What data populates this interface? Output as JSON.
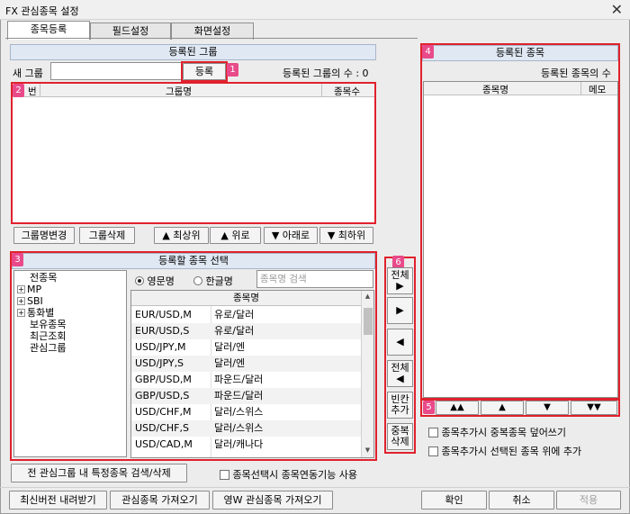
{
  "window": {
    "title": "FX 관심종목 설정",
    "close": "✕"
  },
  "tabs": [
    {
      "label": "종목등록"
    },
    {
      "label": "필드설정"
    },
    {
      "label": "화면설정"
    }
  ],
  "groups": {
    "header": "등록된 그룹",
    "new_group_label": "새 그룹",
    "new_group_value": "",
    "register_button": "등록",
    "count_label": "등록된 그룹의 수 : 0",
    "columns": [
      "번",
      "그룹명",
      "종목수"
    ],
    "buttons": {
      "rename": "그룹명변경",
      "delete": "그룹삭제",
      "top": "▲ 최상위",
      "up": "▲ 위로",
      "down": "▼ 아래로",
      "bottom": "▼ 최하위"
    }
  },
  "badges": [
    "1",
    "2",
    "3",
    "4",
    "5",
    "6"
  ],
  "selection": {
    "header": "등록할 종목 선택",
    "tree": [
      {
        "label": "전종목",
        "expandable": false
      },
      {
        "label": "MP",
        "expandable": true
      },
      {
        "label": "SBI",
        "expandable": true
      },
      {
        "label": "통화별",
        "expandable": true
      },
      {
        "label": "보유종목",
        "expandable": false
      },
      {
        "label": "최근조회",
        "expandable": false
      },
      {
        "label": "관심그룹",
        "expandable": false
      }
    ],
    "radio_english": "영문명",
    "radio_korean": "한글명",
    "search_placeholder": "종목명 검색",
    "column": "종목명",
    "symbols": [
      {
        "code": "EUR/USD,M",
        "name": "유로/달러"
      },
      {
        "code": "EUR/USD,S",
        "name": "유로/달러"
      },
      {
        "code": "USD/JPY,M",
        "name": "달러/엔"
      },
      {
        "code": "USD/JPY,S",
        "name": "달러/엔"
      },
      {
        "code": "GBP/USD,M",
        "name": "파운드/달러"
      },
      {
        "code": "GBP/USD,S",
        "name": "파운드/달러"
      },
      {
        "code": "USD/CHF,M",
        "name": "달러/스위스"
      },
      {
        "code": "USD/CHF,S",
        "name": "달러/스위스"
      },
      {
        "code": "USD/CAD,M",
        "name": "달러/캐나다"
      }
    ]
  },
  "transfer": {
    "all_right_line1": "전체",
    "all_right_arrow": "▶",
    "right": "▶",
    "left": "◀",
    "all_left_line1": "전체",
    "all_left_arrow": "◀",
    "blank_add_line1": "빈칸",
    "blank_add_line2": "추가",
    "dup_del_line1": "중복",
    "dup_del_line2": "삭제"
  },
  "registered": {
    "header": "등록된 종목",
    "count_label": "등록된 종목의 수",
    "columns": [
      "종목명",
      "메모"
    ],
    "move": [
      "▲▲",
      "▲",
      "▼",
      "▼▼"
    ],
    "opt_overwrite": "종목추가시 중복종목 덮어쓰기",
    "opt_above": "종목추가시 선택된 종목 위에 추가"
  },
  "bottom": {
    "search_in_groups": "전 관심그룹 내 특정종목 검색/삭제",
    "link_option": "종목선택시 종목연동기능 사용",
    "download_latest": "최신버전 내려받기",
    "import_favorites": "관심종목 가져오기",
    "import_yw": "영W 관심종목 가져오기",
    "ok": "확인",
    "cancel": "취소",
    "apply": "적용"
  }
}
